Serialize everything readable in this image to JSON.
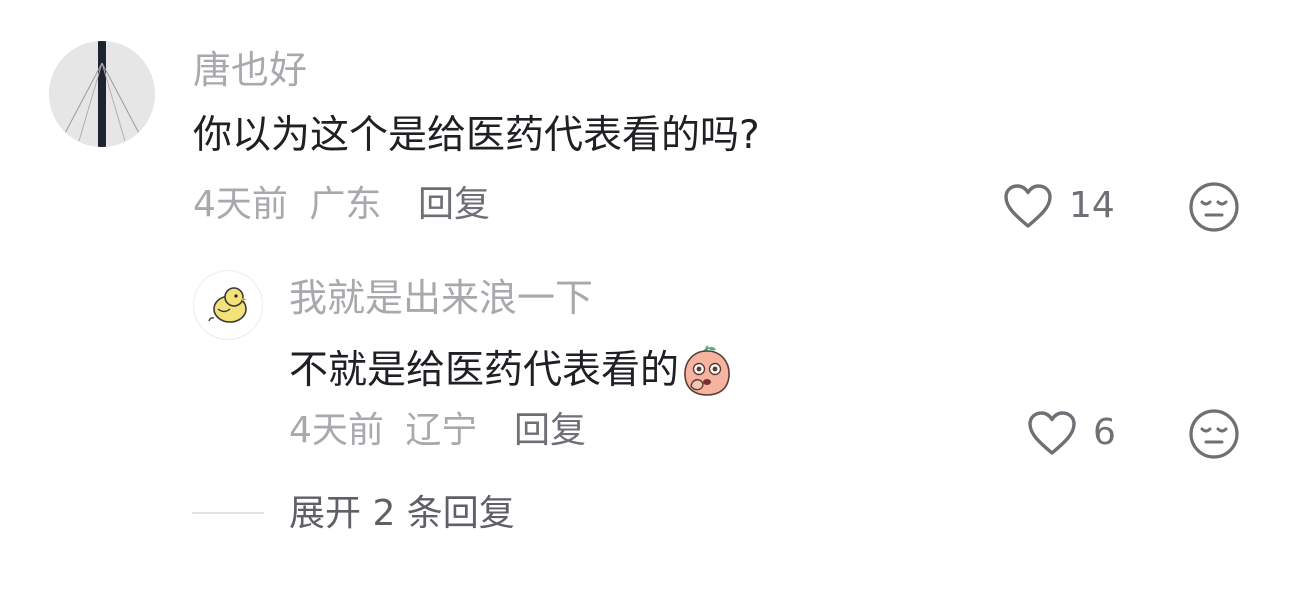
{
  "comments": [
    {
      "username": "唐也好",
      "text": "你以为这个是给医药代表看的吗?",
      "time": "4天前",
      "location": "广东",
      "reply_label": "回复",
      "likes": "14"
    }
  ],
  "reply": {
    "username": "我就是出来浪一下",
    "text": "不就是给医药代表看的",
    "emoji": "peach-shy-emoji",
    "time": "4天前",
    "location": "辽宁",
    "reply_label": "回复",
    "likes": "6"
  },
  "expand_label": "展开 2 条回复",
  "icons": {
    "like": "heart-outline-icon",
    "dislike": "neutral-face-icon"
  },
  "colors": {
    "username": "#a8a8ad",
    "content": "#1f1f24",
    "meta": "#a8a8ad",
    "action": "#6f6f76"
  }
}
